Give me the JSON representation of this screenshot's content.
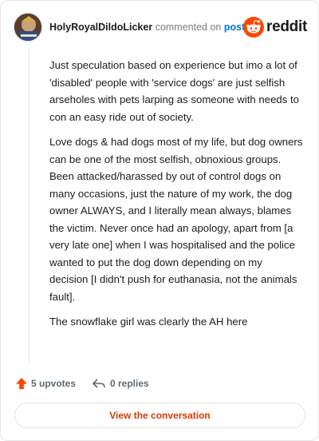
{
  "comment": {
    "username": "HolyRoyalDildoLicker",
    "commented_text": "commented on",
    "post_link": "post",
    "paragraphs": [
      "Just speculation based on experience but imo a lot of 'disabled' people with 'service dogs' are just selfish arseholes with pets larping as someone with needs to con an easy ride out of society.",
      "Love dogs & had dogs most of my life, but dog owners can be one of the most selfish, obnoxious groups. Been attacked/harassed by out of control dogs on many occasions, just the nature of my work, the dog owner ALWAYS, and I literally mean always, blames the victim. Never once had an apology, apart from [a very late one] when I was hospitalised and the police wanted to put the dog down depending on my decision [I didn't push for euthanasia, not the animals fault].",
      "The snowflake girl was clearly the AH here"
    ]
  },
  "brand": {
    "name": "reddit",
    "icon": "reddit-snoo-icon",
    "color": "#ff4500"
  },
  "actions": {
    "upvotes": "5 upvotes",
    "replies": "0 replies",
    "upvote_icon": "upvote-arrow-icon",
    "reply_icon": "reply-arrow-icon"
  },
  "view_button": "View the conversation",
  "colors": {
    "accent_orange": "#ff4500",
    "link_blue": "#0079d3",
    "button_text": "#d93a00"
  }
}
